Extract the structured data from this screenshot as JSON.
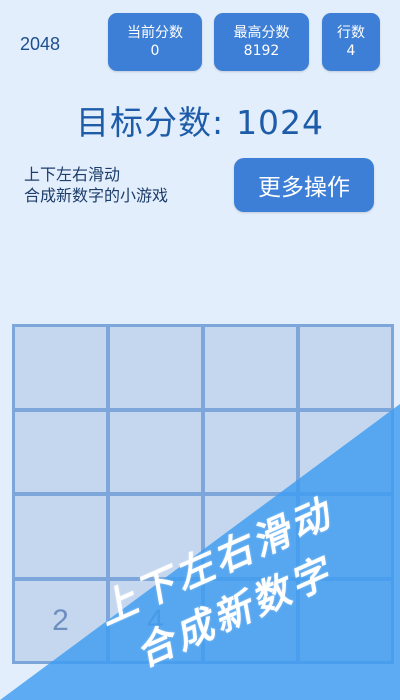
{
  "app": {
    "title": "2048"
  },
  "stats": {
    "score": {
      "label": "当前分数",
      "value": "0"
    },
    "best": {
      "label": "最高分数",
      "value": "8192"
    },
    "rows": {
      "label": "行数",
      "value": "4"
    }
  },
  "target": {
    "label": "目标分数:",
    "value": "1024"
  },
  "hint": {
    "line1": "上下左右滑动",
    "line2": "合成新数字的小游戏"
  },
  "more_button": {
    "label": "更多操作"
  },
  "board": {
    "cells": [
      "",
      "",
      "",
      "",
      "",
      "",
      "",
      "",
      "",
      "",
      "",
      "",
      "2",
      "4",
      "",
      ""
    ]
  },
  "banner": {
    "line1": "上下左右滑动",
    "line2": "合成新数字"
  },
  "colors": {
    "background": "#e3eefc",
    "accent": "#3d7fd6",
    "overlay": "#4aa3f0"
  }
}
